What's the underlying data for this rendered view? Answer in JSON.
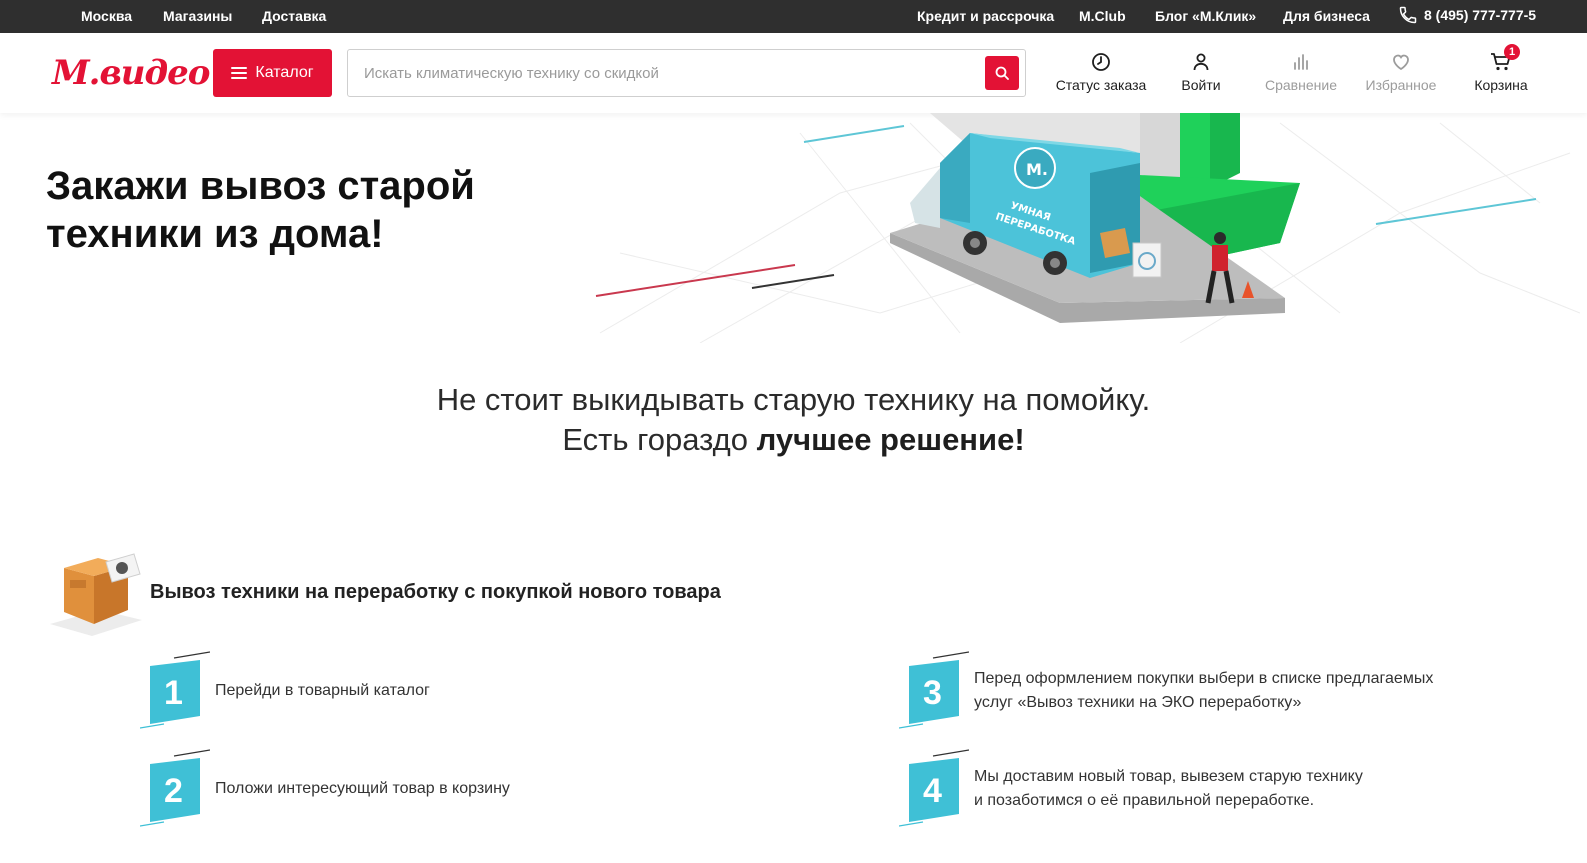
{
  "topbar": {
    "city": "Москва",
    "stores": "Магазины",
    "delivery": "Доставка",
    "credit": "Кредит и рассрочка",
    "mclub": "M.Club",
    "blog": "Блог «М.Клик»",
    "business": "Для бизнеса",
    "phone": "8 (495) 777-777-5"
  },
  "header": {
    "logo": "М.видео",
    "catalog_label": "Каталог",
    "search_placeholder": "Искать климатическую технику со скидкой",
    "order_status": "Статус заказа",
    "login": "Войти",
    "compare": "Сравнение",
    "favorites": "Избранное",
    "cart": "Корзина",
    "cart_count": "1"
  },
  "hero": {
    "title_line1": "Закажи вывоз старой",
    "title_line2": "техники из дома!",
    "truck_brand": "М.",
    "truck_label_line1": "УМНАЯ",
    "truck_label_line2": "ПЕРЕРАБОТКА"
  },
  "lead": {
    "line1": "Не стоит выкидывать старую технику на помойку.",
    "line2_prefix": "Есть гораздо ",
    "line2_bold": "лучшее решение!"
  },
  "section": {
    "title": "Вывоз техники на переработку с покупкой нового товара"
  },
  "steps": [
    {
      "number": "1",
      "text": "Перейди в товарный каталог"
    },
    {
      "number": "2",
      "text": "Положи интересующий товар в корзину"
    },
    {
      "number": "3",
      "text_line1": "Перед оформлением покупки выбери в списке предлагаемых",
      "text_line2": "услуг «Вывоз техники на ЭКО переработку»"
    },
    {
      "number": "4",
      "text_line1": "Мы доставим новый товар, вывезем старую технику",
      "text_line2": "и позаботимся о её правильной переработке."
    }
  ],
  "colors": {
    "brand_red": "#e31235",
    "topbar_bg": "#2f2f2f",
    "step_teal": "#3fc0d6",
    "truck_teal": "#4cc3d9",
    "building_green": "#1fd15a"
  }
}
